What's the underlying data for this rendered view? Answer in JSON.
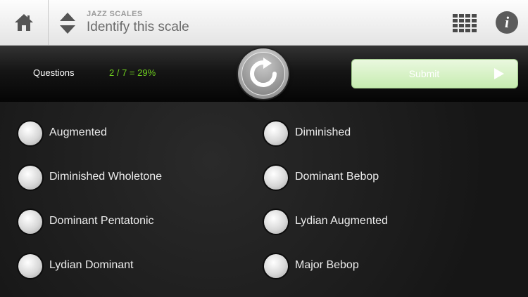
{
  "header": {
    "subtitle": "JAZZ SCALES",
    "title": "Identify this scale",
    "home_icon": "home-icon",
    "sort_icon": "sort-arrows-icon",
    "grid_icon": "grid-menu-icon",
    "info_label": "i"
  },
  "controls": {
    "questions_label": "Questions",
    "score": "2 / 7 = 29%",
    "replay_icon": "replay-icon",
    "submit_label": "Submit",
    "submit_color": "#c6ecb0",
    "score_color": "#6fce1f"
  },
  "options": [
    {
      "label": "Augmented"
    },
    {
      "label": "Diminished"
    },
    {
      "label": "Diminished Wholetone"
    },
    {
      "label": "Dominant Bebop"
    },
    {
      "label": "Dominant Pentatonic"
    },
    {
      "label": "Lydian Augmented"
    },
    {
      "label": "Lydian Dominant"
    },
    {
      "label": "Major Bebop"
    }
  ]
}
